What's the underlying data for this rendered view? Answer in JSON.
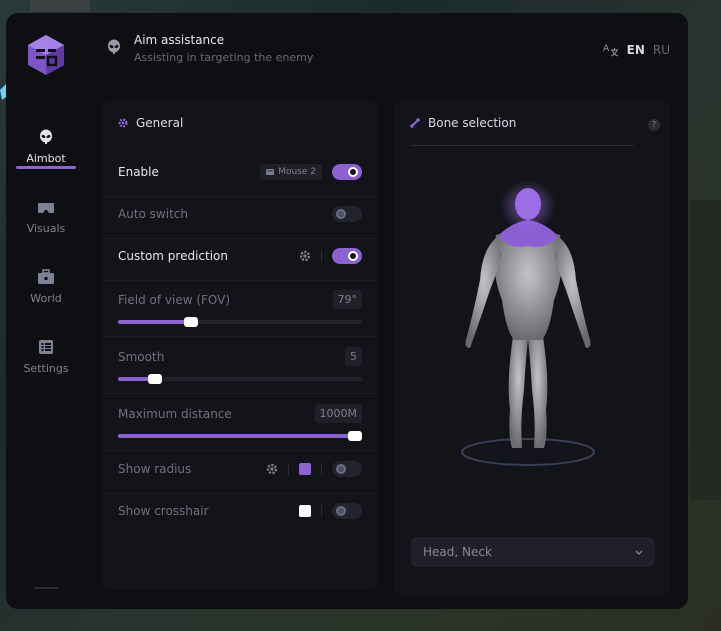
{
  "header": {
    "title": "Aim assistance",
    "subtitle": "Assisting in targeting the enemy",
    "lang_en": "EN",
    "lang_ru": "RU"
  },
  "sidebar": {
    "items": [
      {
        "label": "Aimbot",
        "icon": "alien-icon",
        "active": true
      },
      {
        "label": "Visuals",
        "icon": "vr-goggles-icon",
        "active": false
      },
      {
        "label": "World",
        "icon": "toolbox-icon",
        "active": false
      },
      {
        "label": "Settings",
        "icon": "list-icon",
        "active": false
      }
    ]
  },
  "general": {
    "title": "General",
    "enable": {
      "label": "Enable",
      "key": "Mouse 2",
      "on": true
    },
    "auto_switch": {
      "label": "Auto switch",
      "on": false
    },
    "custom_prediction": {
      "label": "Custom prediction",
      "on": true
    },
    "fov": {
      "label": "Field of view (FOV)",
      "value": "79°",
      "fraction": 0.3
    },
    "smooth": {
      "label": "Smooth",
      "value": "5",
      "fraction": 0.15
    },
    "max_distance": {
      "label": "Maximum distance",
      "value": "1000M",
      "fraction": 1.0
    },
    "show_radius": {
      "label": "Show radius",
      "color": "#8b62d1",
      "on": false
    },
    "show_crosshair": {
      "label": "Show crosshair",
      "color": "#ffffff",
      "on": false
    }
  },
  "bone": {
    "title": "Bone selection",
    "help": "?",
    "selected": "Head, Neck"
  },
  "colors": {
    "accent": "#8b62d1",
    "panel": "#131419",
    "window": "#0e0f13"
  }
}
